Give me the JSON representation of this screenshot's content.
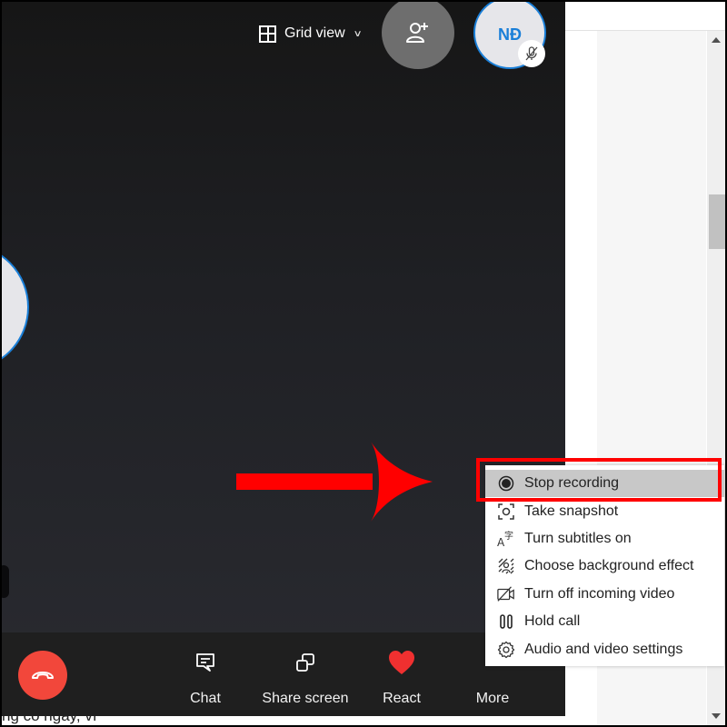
{
  "call": {
    "view_selector": {
      "label": "Grid view",
      "icon": "grid-icon",
      "caret": "chevron-down-icon"
    },
    "add_participant": {
      "icon": "add-person-icon"
    },
    "self_avatar": {
      "initials": "NĐ",
      "status_icon": "mic-off-icon"
    },
    "bottom_bar": {
      "end_call": {
        "icon": "hang-up-icon"
      },
      "buttons": [
        {
          "label": "Chat",
          "icon": "chat-icon"
        },
        {
          "label": "Share screen",
          "icon": "share-screen-icon"
        },
        {
          "label": "React",
          "icon": "heart-icon"
        },
        {
          "label": "More",
          "icon": "more-icon"
        }
      ]
    }
  },
  "more_menu": {
    "items": [
      {
        "label": "Stop recording",
        "icon": "record-icon",
        "highlighted": true
      },
      {
        "label": "Take snapshot",
        "icon": "snapshot-icon"
      },
      {
        "label": "Turn subtitles on",
        "icon": "subtitles-icon"
      },
      {
        "label": "Choose background effect",
        "icon": "background-effect-icon"
      },
      {
        "label": "Turn off incoming video",
        "icon": "video-off-icon"
      },
      {
        "label": "Hold call",
        "icon": "hold-icon"
      },
      {
        "label": "Audio and video settings",
        "icon": "gear-icon"
      }
    ]
  },
  "document": {
    "visible_text": "ng có ngày, vì"
  },
  "colors": {
    "accent_blue": "#1a7fd8",
    "end_call_red": "#f2473b",
    "annotation_red": "#ff0000",
    "react_heart": "#f03030"
  }
}
